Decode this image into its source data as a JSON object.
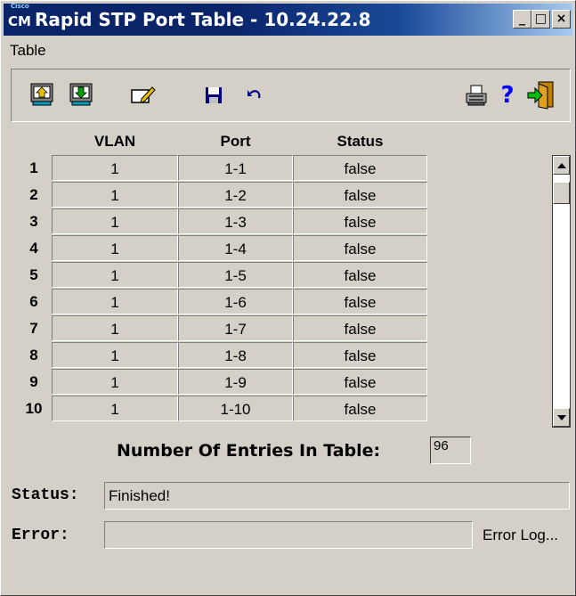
{
  "window": {
    "logo_text": "CM",
    "logo_small_text": "Cisco",
    "title": "Rapid STP Port Table - 10.24.22.8",
    "controls": {
      "minimize": "_",
      "maximize": "□",
      "close": "×"
    }
  },
  "menu": [
    "Table"
  ],
  "toolbar": {
    "left": [
      "upload-icon",
      "download-icon",
      "edit-icon",
      "save-icon",
      "undo-icon"
    ],
    "right": [
      "print-icon",
      "help-icon",
      "exit-icon"
    ]
  },
  "table": {
    "columns": [
      "VLAN",
      "Port",
      "Status"
    ],
    "rows": [
      {
        "num": "1",
        "vlan": "1",
        "port": "1-1",
        "status": "false"
      },
      {
        "num": "2",
        "vlan": "1",
        "port": "1-2",
        "status": "false"
      },
      {
        "num": "3",
        "vlan": "1",
        "port": "1-3",
        "status": "false"
      },
      {
        "num": "4",
        "vlan": "1",
        "port": "1-4",
        "status": "false"
      },
      {
        "num": "5",
        "vlan": "1",
        "port": "1-5",
        "status": "false"
      },
      {
        "num": "6",
        "vlan": "1",
        "port": "1-6",
        "status": "false"
      },
      {
        "num": "7",
        "vlan": "1",
        "port": "1-7",
        "status": "false"
      },
      {
        "num": "8",
        "vlan": "1",
        "port": "1-8",
        "status": "false"
      },
      {
        "num": "9",
        "vlan": "1",
        "port": "1-9",
        "status": "false"
      },
      {
        "num": "10",
        "vlan": "1",
        "port": "1-10",
        "status": "false"
      }
    ]
  },
  "entries": {
    "label": "Number Of Entries In Table:",
    "value": "96"
  },
  "status": {
    "label": "Status:",
    "value": "Finished!"
  },
  "error": {
    "label": "Error:",
    "value": "",
    "log_label": "Error Log..."
  }
}
